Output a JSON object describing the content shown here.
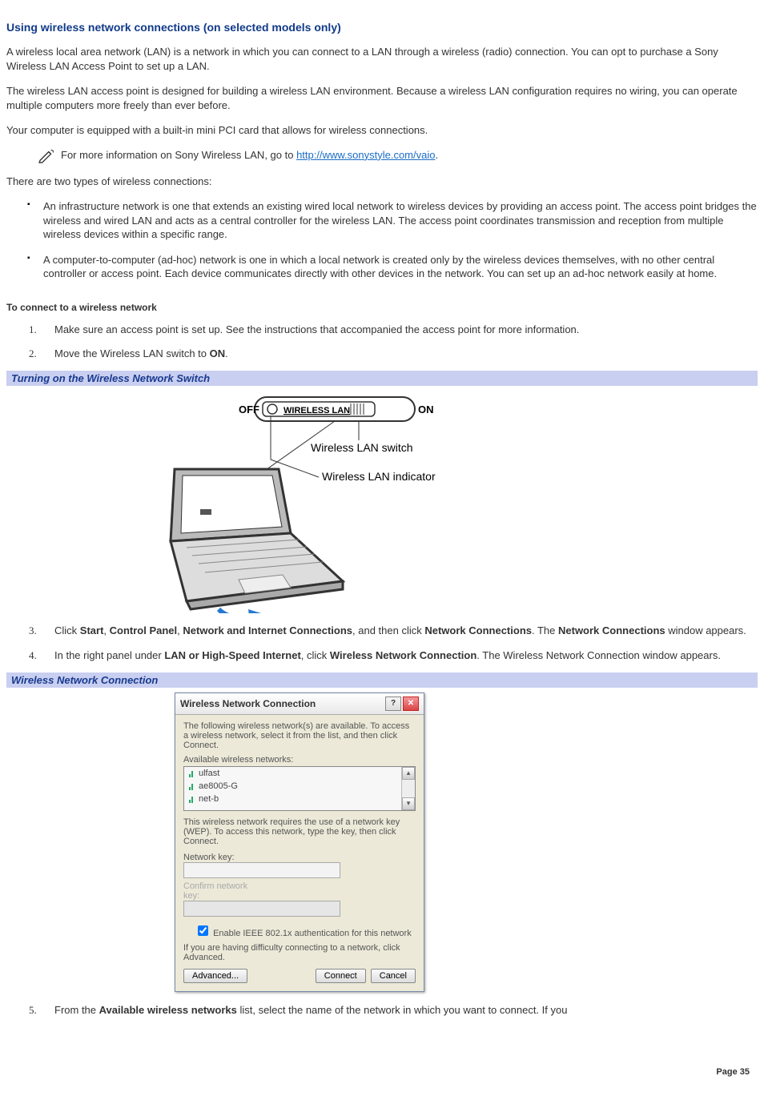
{
  "heading": "Using wireless network connections (on selected models only)",
  "p1": "A wireless local area network (LAN) is a network in which you can connect to a LAN through a wireless (radio) connection. You can opt to purchase a Sony Wireless LAN Access Point to set up a LAN.",
  "p2": "The wireless LAN access point is designed for building a wireless LAN environment. Because a wireless LAN configuration requires no wiring, you can operate multiple computers more freely than ever before.",
  "p3": "Your computer is equipped with a built-in mini PCI card that allows for wireless connections.",
  "note_prefix": "For more information on Sony Wireless LAN, go to ",
  "note_link": "http://www.sonystyle.com/vaio",
  "note_suffix": ".",
  "p4": "There are two types of wireless connections:",
  "bullet1": "An infrastructure network is one that extends an existing wired local network to wireless devices by providing an access point. The access point bridges the wireless and wired LAN and acts as a central controller for the wireless LAN. The access point coordinates transmission and reception from multiple wireless devices within a specific range.",
  "bullet2": "A computer-to-computer (ad-hoc) network is one in which a local network is created only by the wireless devices themselves, with no other central controller or access point. Each device communicates directly with other devices in the network. You can set up an ad-hoc network easily at home.",
  "sub1": "To connect to a wireless network",
  "step1": "Make sure an access point is set up. See the instructions that accompanied the access point for more information.",
  "step2_pre": "Move the Wireless LAN switch to ",
  "step2_bold": "ON",
  "step2_post": ".",
  "caption1": "Turning on the Wireless Network Switch",
  "fig": {
    "off": "OFF",
    "on": "ON",
    "switch_text": "WIRELESS LAN",
    "label_switch": "Wireless LAN switch",
    "label_indicator": "Wireless LAN indicator"
  },
  "step3_parts": {
    "a": "Click ",
    "b": "Start",
    "c": ", ",
    "d": "Control Panel",
    "e": ", ",
    "f": "Network and Internet Connections",
    "g": ", and then click ",
    "h": "Network Connections",
    "i": ". The ",
    "j": "Network Connections",
    "k": " window appears."
  },
  "step4_parts": {
    "a": "In the right panel under ",
    "b": "LAN or High-Speed Internet",
    "c": ", click ",
    "d": "Wireless Network Connection",
    "e": ". The Wireless Network Connection window appears."
  },
  "caption2": "Wireless Network Connection",
  "dialog": {
    "title": "Wireless Network Connection",
    "intro": "The following wireless network(s) are available. To access a wireless network, select it from the list, and then click Connect.",
    "avail_label": "Available wireless networks:",
    "items": [
      "ulfast",
      "ae8005-G",
      "net-b"
    ],
    "wep_text": "This wireless network requires the use of a network key (WEP). To access this network, type the key, then click Connect.",
    "netkey_label": "Network key:",
    "confirm_label": "Confirm network key:",
    "checkbox": "Enable IEEE 802.1x authentication for this network",
    "difficulty": "If you are having difficulty connecting to a network, click Advanced.",
    "btn_advanced": "Advanced...",
    "btn_connect": "Connect",
    "btn_cancel": "Cancel"
  },
  "step5_parts": {
    "a": "From the ",
    "b": "Available wireless networks",
    "c": " list, select the name of the network in which you want to connect. If you"
  },
  "page_number": "Page 35"
}
